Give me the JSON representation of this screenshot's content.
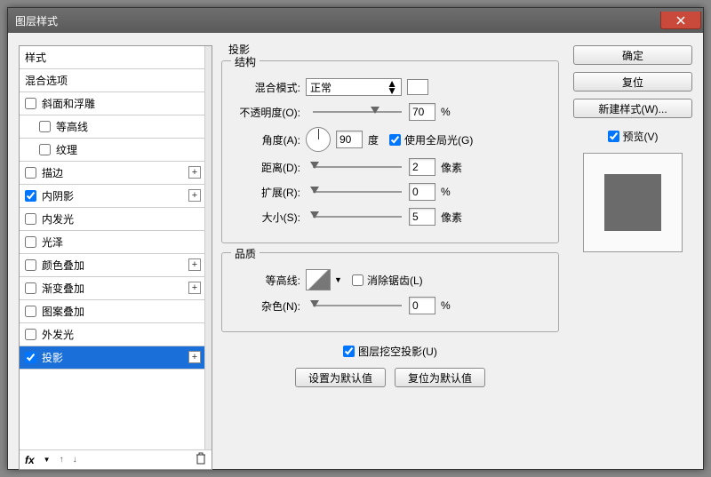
{
  "window": {
    "title": "图层样式"
  },
  "styles": {
    "header_styles": "样式",
    "header_blend": "混合选项",
    "items": [
      {
        "label": "斜面和浮雕",
        "checked": false,
        "plus": false,
        "indent": false
      },
      {
        "label": "等高线",
        "checked": false,
        "plus": false,
        "indent": true
      },
      {
        "label": "纹理",
        "checked": false,
        "plus": false,
        "indent": true
      },
      {
        "label": "描边",
        "checked": false,
        "plus": true,
        "indent": false
      },
      {
        "label": "内阴影",
        "checked": true,
        "plus": true,
        "indent": false
      },
      {
        "label": "内发光",
        "checked": false,
        "plus": false,
        "indent": false
      },
      {
        "label": "光泽",
        "checked": false,
        "plus": false,
        "indent": false
      },
      {
        "label": "颜色叠加",
        "checked": false,
        "plus": true,
        "indent": false
      },
      {
        "label": "渐变叠加",
        "checked": false,
        "plus": true,
        "indent": false
      },
      {
        "label": "图案叠加",
        "checked": false,
        "plus": false,
        "indent": false
      },
      {
        "label": "外发光",
        "checked": false,
        "plus": false,
        "indent": false
      },
      {
        "label": "投影",
        "checked": true,
        "plus": true,
        "indent": false,
        "selected": true
      }
    ],
    "footer_fx": "fx"
  },
  "panel": {
    "title": "投影",
    "structure": {
      "legend": "结构",
      "blend_mode_label": "混合模式:",
      "blend_mode_value": "正常",
      "opacity_label": "不透明度(O):",
      "opacity_value": "70",
      "opacity_unit": "%",
      "angle_label": "角度(A):",
      "angle_value": "90",
      "angle_unit": "度",
      "global_light_label": "使用全局光(G)",
      "global_light_checked": true,
      "distance_label": "距离(D):",
      "distance_value": "2",
      "distance_unit": "像素",
      "spread_label": "扩展(R):",
      "spread_value": "0",
      "spread_unit": "%",
      "size_label": "大小(S):",
      "size_value": "5",
      "size_unit": "像素"
    },
    "quality": {
      "legend": "品质",
      "contour_label": "等高线:",
      "antialias_label": "消除锯齿(L)",
      "antialias_checked": false,
      "noise_label": "杂色(N):",
      "noise_value": "0",
      "noise_unit": "%"
    },
    "knockout_label": "图层挖空投影(U)",
    "knockout_checked": true,
    "btn_default": "设置为默认值",
    "btn_reset": "复位为默认值"
  },
  "right": {
    "ok": "确定",
    "cancel": "复位",
    "new_style": "新建样式(W)...",
    "preview_label": "预览(V)",
    "preview_checked": true
  }
}
